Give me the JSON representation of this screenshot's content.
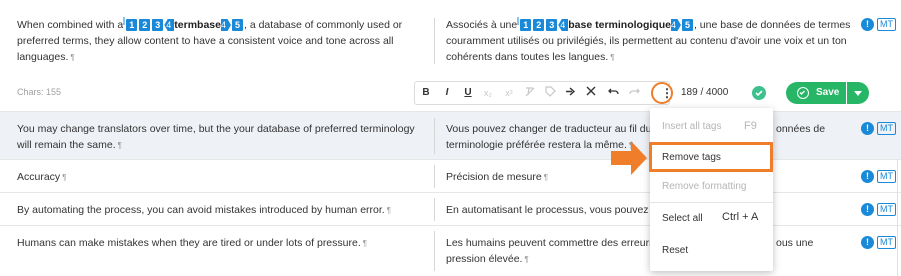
{
  "segments": [
    {
      "source_prefix": "When combined with a",
      "source_tag_nums": [
        "1",
        "2",
        "3",
        "4"
      ],
      "source_bold": "termbase",
      "source_close_nums": [
        "4",
        "5"
      ],
      "source_rest": ", a database of commonly used or preferred terms, they allow content to have a consistent voice and tone across all languages.",
      "target_prefix": "Associés à une",
      "target_tag_nums": [
        "1",
        "2",
        "3",
        "4"
      ],
      "target_bold": "base terminologique",
      "target_close_nums": [
        "4",
        "5"
      ],
      "target_rest": ", une base de données de termes couramment utilisés ou privilégiés, ils permettent au contenu d'avoir une voix et un ton cohérents dans toutes les langues.",
      "badge_info": "!",
      "badge_mt": "MT"
    },
    {
      "source": "You may change translators over time, but the your database of preferred terminology will remain the same.",
      "target": "Vous pouvez changer de traducteur au fil du te",
      "target_tail": "onnées de",
      "target_line2": "terminologie préférée restera la même.",
      "badge_info": "!",
      "badge_mt": "MT"
    },
    {
      "source": "Accuracy",
      "target": "Précision de mesure",
      "badge_info": "!",
      "badge_mt": "MT"
    },
    {
      "source": "By automating the process, you can avoid mistakes introduced by human error.",
      "target": "En automatisant le processus, vous pouvez év",
      "badge_info": "!",
      "badge_mt": "MT"
    },
    {
      "source": "Humans can make mistakes when they are tired or under lots of pressure.",
      "target": "Les humains peuvent commettre des erreurs l",
      "target_tail": "ous une",
      "target_line2": "pression élevée.",
      "badge_info": "!",
      "badge_mt": "MT"
    }
  ],
  "pilcrow": "¶",
  "toolbar": {
    "chars_label": "Chars: 155",
    "bold": "B",
    "italic": "I",
    "underline": "U",
    "subscript": "x₂",
    "superscript": "x²",
    "counter": "189 / 4000",
    "save_label": "Save",
    "more_glyph": "⋮"
  },
  "context_menu": {
    "items": [
      {
        "label": "Insert all tags",
        "shortcut": "F9",
        "enabled": false
      },
      {
        "label": "Remove tags",
        "shortcut": "",
        "enabled": true
      },
      {
        "label": "Remove formatting",
        "shortcut": "",
        "enabled": false
      },
      {
        "label": "Select all",
        "shortcut": "Ctrl + A",
        "enabled": true
      },
      {
        "label": "Reset",
        "shortcut": "",
        "enabled": true
      }
    ]
  },
  "colors": {
    "tag_blue": "#1a8ad8",
    "save_green": "#27b566",
    "annotation_orange": "#ef7d2a",
    "highlight_row": "#eef1f6"
  }
}
